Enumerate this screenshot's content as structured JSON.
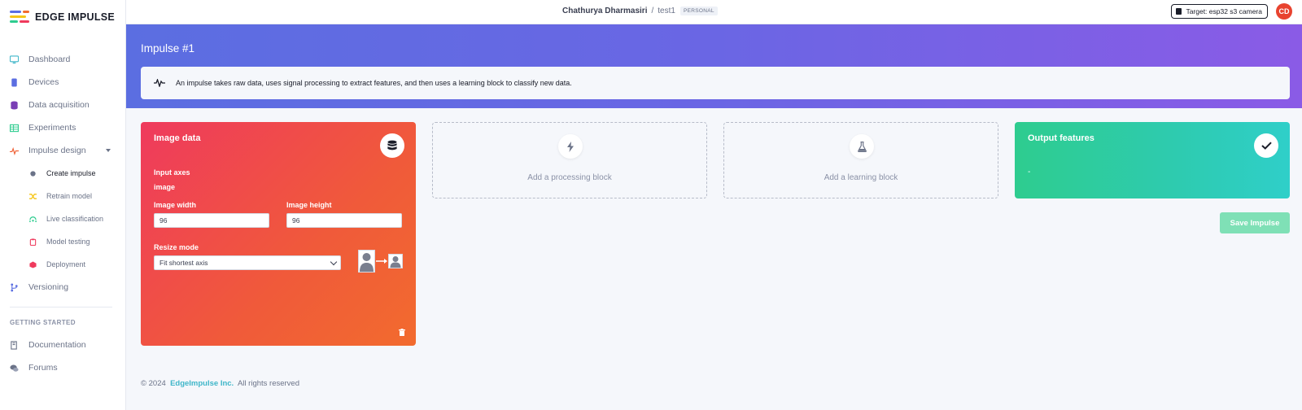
{
  "brand": {
    "name": "EDGE IMPULSE"
  },
  "sidebar": {
    "items": [
      {
        "label": "Dashboard",
        "icon": "monitor-icon",
        "color": "#3fb6c9"
      },
      {
        "label": "Devices",
        "icon": "device-icon",
        "color": "#5b6ee1"
      },
      {
        "label": "Data acquisition",
        "icon": "database-icon",
        "color": "#7a3fb5"
      },
      {
        "label": "Experiments",
        "icon": "table-icon",
        "color": "#2ecc8f"
      },
      {
        "label": "Impulse design",
        "icon": "pulse-icon",
        "color": "#f0643a"
      }
    ],
    "sub_items": [
      {
        "label": "Create impulse",
        "icon": "dot-icon",
        "color": "#6b7388"
      },
      {
        "label": "Retrain model",
        "icon": "shuffle-icon",
        "color": "#f5c518"
      },
      {
        "label": "Live classification",
        "icon": "signal-icon",
        "color": "#2ecc8f"
      },
      {
        "label": "Model testing",
        "icon": "clipboard-icon",
        "color": "#ef3a5d"
      },
      {
        "label": "Deployment",
        "icon": "cube-icon",
        "color": "#ef3a5d"
      }
    ],
    "versioning": {
      "label": "Versioning",
      "icon": "branch-icon",
      "color": "#5b6ee1"
    },
    "section_title": "GETTING STARTED",
    "footer_items": [
      {
        "label": "Documentation",
        "icon": "book-icon"
      },
      {
        "label": "Forums",
        "icon": "chat-icon"
      }
    ]
  },
  "topbar": {
    "user": "Chathurya Dharmasiri",
    "separator": "/",
    "project": "test1",
    "badge": "PERSONAL",
    "target_label": "Target: esp32 s3 camera",
    "avatar_initials": "CD"
  },
  "banner": {
    "title": "Impulse #1",
    "info": "An impulse takes raw data, uses signal processing to extract features, and then uses a learning block to classify new data."
  },
  "image_block": {
    "title": "Image data",
    "input_axes_label": "Input axes",
    "input_axes_value": "image",
    "width_label": "Image width",
    "width_value": "96",
    "height_label": "Image height",
    "height_value": "96",
    "resize_label": "Resize mode",
    "resize_value": "Fit shortest axis"
  },
  "processing_block": {
    "label": "Add a processing block"
  },
  "learning_block": {
    "label": "Add a learning block"
  },
  "output_block": {
    "title": "Output features",
    "value": "-"
  },
  "save_button": "Save Impulse",
  "footer": {
    "copyright": "© 2024",
    "company": "EdgeImpulse Inc.",
    "rights": "All rights reserved"
  }
}
